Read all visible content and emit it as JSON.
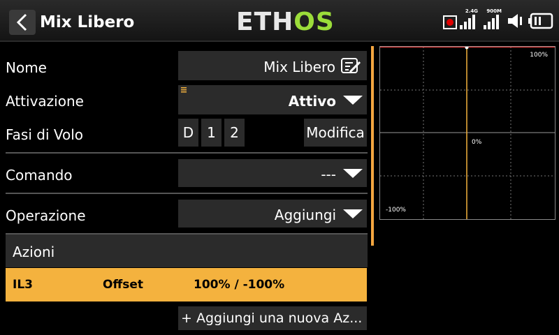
{
  "header": {
    "title": "Mix Libero",
    "logo_left": "ETH",
    "logo_right": "OS",
    "signal1_label": "2.4G",
    "signal2_label": "900M"
  },
  "form": {
    "name_label": "Nome",
    "name_value": "Mix Libero",
    "activation_label": "Attivazione",
    "activation_value": "Attivo",
    "flight_modes_label": "Fasi di Volo",
    "flight_modes": [
      "D",
      "1",
      "2"
    ],
    "modify_label": "Modifica",
    "command_label": "Comando",
    "command_value": "---",
    "operation_label": "Operazione",
    "operation_value": "Aggiungi"
  },
  "actions": {
    "header": "Azioni",
    "rows": [
      {
        "source": "IL3",
        "type": "Offset",
        "value": "100% / -100%"
      }
    ],
    "add_label": "+ Aggiungi una nuova Az..."
  },
  "graph": {
    "top_label": "100%",
    "mid_label": "0%",
    "bottom_label": "-100%"
  },
  "colors": {
    "accent": "#f4b23e",
    "logo_green": "#9bdc3a",
    "record_red": "#e00000"
  }
}
